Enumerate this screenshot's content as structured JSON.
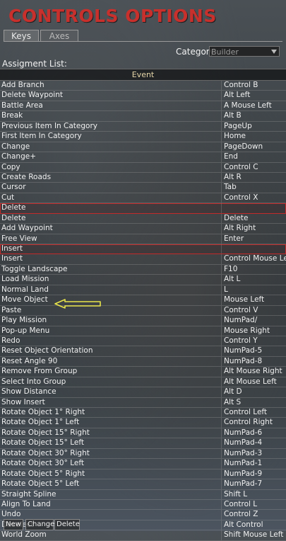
{
  "title": "CONTROLS OPTIONS",
  "tabs": [
    {
      "label": "Keys",
      "active": true
    },
    {
      "label": "Axes",
      "active": false
    }
  ],
  "category": {
    "label": "Category:",
    "value": "Builder"
  },
  "assignment_list": {
    "label": "Assigment List:",
    "header": "Event",
    "rows": [
      {
        "event": "Add Branch",
        "key": "Control B"
      },
      {
        "event": "Delete Waypoint",
        "key": "Alt Left"
      },
      {
        "event": "Battle Area",
        "key": "A Mouse Left"
      },
      {
        "event": "Break",
        "key": "Alt B"
      },
      {
        "event": "Previous Item In Category",
        "key": "PageUp"
      },
      {
        "event": "First Item In Category",
        "key": "Home"
      },
      {
        "event": "Change",
        "key": "PageDown"
      },
      {
        "event": "Change+",
        "key": "End"
      },
      {
        "event": "Copy",
        "key": "Control C"
      },
      {
        "event": "Create Roads",
        "key": "Alt R"
      },
      {
        "event": "Cursor",
        "key": "Tab"
      },
      {
        "event": "Cut",
        "key": "Control X"
      },
      {
        "event": "Delete",
        "key": "",
        "highlighted": true
      },
      {
        "event": "Delete",
        "key": "Delete"
      },
      {
        "event": "Add Waypoint",
        "key": "Alt Right"
      },
      {
        "event": "Free View",
        "key": "Enter"
      },
      {
        "event": "Insert",
        "key": "",
        "highlighted": true
      },
      {
        "event": "Insert",
        "key": "Control Mouse Left"
      },
      {
        "event": "Toggle Landscape",
        "key": "F10"
      },
      {
        "event": "Load Mission",
        "key": "Alt L"
      },
      {
        "event": "Normal Land",
        "key": "L"
      },
      {
        "event": "Move Object",
        "key": "Mouse Left"
      },
      {
        "event": "Paste",
        "key": "Control V"
      },
      {
        "event": "Play Mission",
        "key": "NumPad/"
      },
      {
        "event": "Pop-up Menu",
        "key": "Mouse Right"
      },
      {
        "event": "Redo",
        "key": "Control Y"
      },
      {
        "event": "Reset Object Orientation",
        "key": "NumPad-5"
      },
      {
        "event": "Reset Angle 90",
        "key": "NumPad-8"
      },
      {
        "event": "Remove From Group",
        "key": "Alt Mouse Right"
      },
      {
        "event": "Select Into Group",
        "key": "Alt Mouse Left"
      },
      {
        "event": "Show Distance",
        "key": "Alt D"
      },
      {
        "event": "Show Insert",
        "key": "Alt S"
      },
      {
        "event": "Rotate Object 1° Right",
        "key": "Control Left"
      },
      {
        "event": "Rotate Object 1° Left",
        "key": "Control Right"
      },
      {
        "event": "Rotate Object 15° Right",
        "key": "NumPad-6"
      },
      {
        "event": "Rotate Object 15° Left",
        "key": "NumPad-4"
      },
      {
        "event": "Rotate Object 30° Right",
        "key": "NumPad-3"
      },
      {
        "event": "Rotate Object 30° Left",
        "key": "NumPad-1"
      },
      {
        "event": "Rotate Object 5° Right",
        "key": "NumPad-9"
      },
      {
        "event": "Rotate Object 5° Left",
        "key": "NumPad-7"
      },
      {
        "event": "Straight Spline",
        "key": "Shift L"
      },
      {
        "event": "Align To Land",
        "key": "Control L"
      },
      {
        "event": "Undo",
        "key": "Control Z"
      },
      {
        "event": "Deselect",
        "key": "Alt Control"
      },
      {
        "event": "World Zoom",
        "key": "Shift Mouse Left"
      }
    ]
  },
  "buttons": {
    "new": "New",
    "change": "Change",
    "delete": "Delete"
  },
  "colors": {
    "title": "#c8302c",
    "highlight_border": "#c22a2a",
    "arrow": "#e8e44a",
    "header_text": "#e6d6a8"
  },
  "annotation": {
    "icon": "yellow-arrow-icon",
    "points_to": "Play Mission"
  }
}
